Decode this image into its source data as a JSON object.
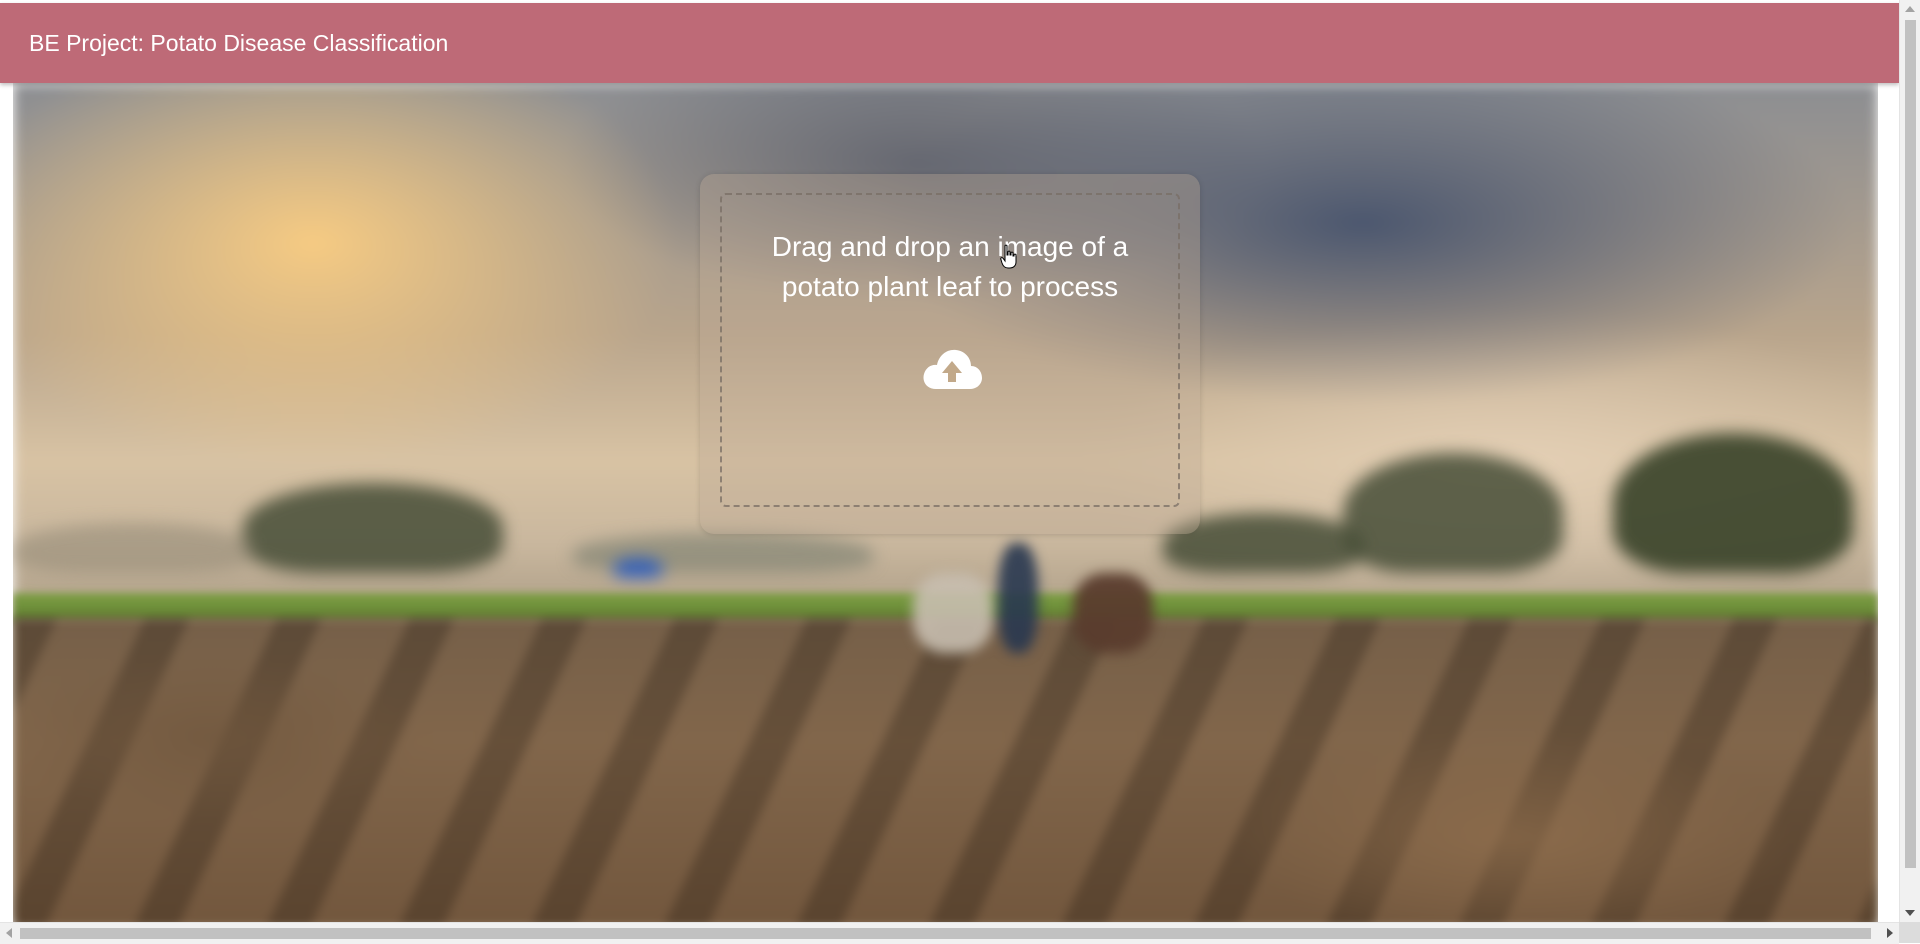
{
  "appbar": {
    "title": "BE Project: Potato Disease Classification",
    "color": "#be6a77"
  },
  "upload": {
    "prompt": "Drag and drop an image of a potato plant leaf to process",
    "icon": "cloud-upload-icon"
  },
  "background": {
    "description_icon": "field-background-image"
  },
  "cursor": {
    "icon": "hand-pointer-icon"
  }
}
